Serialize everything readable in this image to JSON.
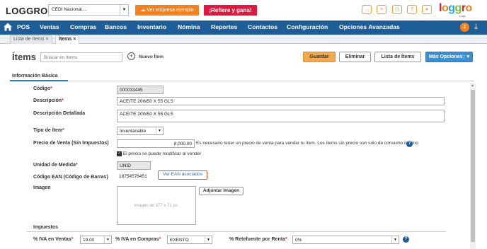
{
  "app": {
    "logo": "LOGGRO",
    "brand": "loggro",
    "brand_sub": "by siigo"
  },
  "company": {
    "selected": "CEDI Nacional...."
  },
  "promo": {
    "example_company": "Ver empresa ejemplo",
    "refer": "¡Refiere y gana!"
  },
  "nav": {
    "items": [
      "POS",
      "Ventas",
      "Compras",
      "Bancos",
      "Inventario",
      "Nómina",
      "Reportes",
      "Contactos",
      "Configuración",
      "Opciones Avanzadas"
    ],
    "badge": "2"
  },
  "tabs": [
    {
      "label": "Lista de ítems ×"
    },
    {
      "label": "Ítems ×"
    }
  ],
  "header": {
    "title": "Ítems",
    "search_placeholder": "Buscar en Ítems",
    "new_item": "Nuevo Ítem",
    "save": "Guardar",
    "delete": "Eliminar",
    "list": "Lista de Ítems",
    "more": "Más Opciones"
  },
  "section": {
    "tab": "Información Básica"
  },
  "form": {
    "code_label": "Código",
    "code_value": "000033445",
    "desc_label": "Descripción",
    "desc_value": "ACEITE 20W50 X 55 GLS",
    "desc_det_label": "Descripción Detallada",
    "desc_det_value": "ACEITE 20W50 X 55 GLS",
    "type_label": "Tipo de Ítem",
    "type_value": "Inventariable",
    "price_label": "Precio de Venta (Sin Impuestos)",
    "price_value": "8,000.00",
    "price_note": "Es necesario tener un precio de venta para vender tu ítem. Los ítems sin precio son solo de consumo interno",
    "price_check": "El precio se puede modificar al vender",
    "unit_label": "Unidad de Medida",
    "unit_value": "UNID",
    "ean_label": "Código EAN (Código de Barras)",
    "ean_value": "18754576451",
    "ean_button": "Ver EAN asociados",
    "image_label": "Imagen",
    "image_placeholder": "Imagen de 177 x 71 px.",
    "attach_button": "Adjuntar Imagen"
  },
  "taxes": {
    "title": "Impuestos",
    "iva_sales_label": "% IVA en Ventas",
    "iva_sales_value": "19.00",
    "iva_purchase_label": "% IVA en Compras",
    "iva_purchase_value": "EXENTO",
    "retefuente_label": "% Retefuente por Renta",
    "retefuente_value": "0%"
  },
  "colors": {
    "nav": "#1e5d98",
    "accent": "#f5811f",
    "refer": "#e1173f"
  }
}
